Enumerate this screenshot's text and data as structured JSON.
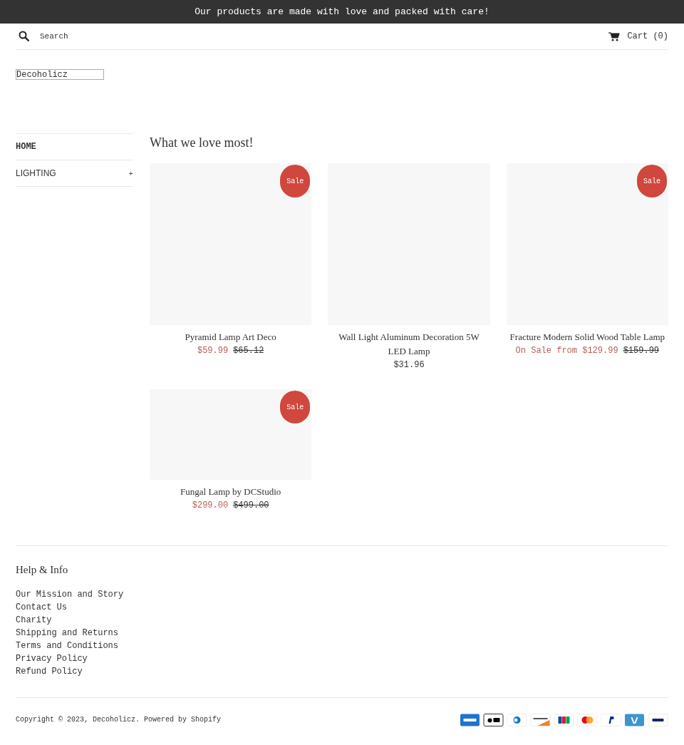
{
  "announcement": "Our products are made with love and packed with care!",
  "header": {
    "search": {
      "placeholder": "Search"
    },
    "cart": "Cart (0)"
  },
  "logo": "Decoholicz",
  "sidebar": {
    "items": [
      {
        "label": "HOME",
        "selected": true,
        "expandable": false
      },
      {
        "label": "LIGHTING",
        "selected": false,
        "expandable": true,
        "toggle": "+"
      }
    ]
  },
  "collection": {
    "title": "What we love most!",
    "products": [
      {
        "name": "Pyramid Lamp Art Deco",
        "kind": "square",
        "on_sale": true,
        "badge": "Sale",
        "price": "$59.99",
        "compare_price": "$65.12"
      },
      {
        "name": "Wall Light Aluminum Decoration 5W LED Lamp",
        "kind": "square",
        "on_sale": false,
        "price": "$31.96"
      },
      {
        "name": "Fracture Modern Solid Wood Table Lamp",
        "kind": "square",
        "on_sale": true,
        "badge": "Sale",
        "price": "On Sale from $129.99",
        "compare_price": "$159.99"
      },
      {
        "name": "Fungal Lamp by DCStudio",
        "kind": "landscape",
        "on_sale": true,
        "badge": "Sale",
        "price": "$299.00",
        "compare_price": "$499.00"
      }
    ]
  },
  "footer": {
    "title": "Help & Info",
    "links": [
      "Our Mission and Story",
      "Contact Us",
      "Charity",
      "Shipping and Returns",
      "Terms and Conditions",
      "Privacy Policy",
      "Refund Policy"
    ],
    "copyright": "Copyright © 2023, ",
    "store_link": "Decoholicz",
    "powered": ". Powered by Shopify",
    "payment_methods": [
      {
        "kind": "amex"
      },
      {
        "kind": "applepay"
      },
      {
        "kind": "diners"
      },
      {
        "kind": "discover"
      },
      {
        "kind": "jcb"
      },
      {
        "kind": "mastercard"
      },
      {
        "kind": "paypal"
      },
      {
        "kind": "venmo"
      },
      {
        "kind": "visa"
      }
    ]
  }
}
